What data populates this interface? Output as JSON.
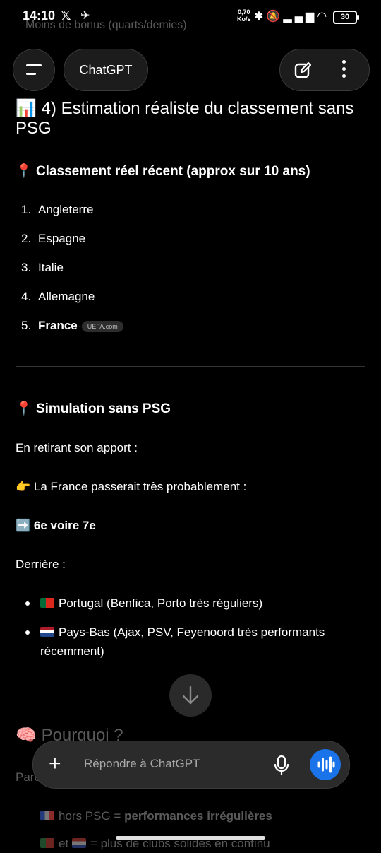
{
  "status": {
    "time": "14:10",
    "speed_value": "0,70",
    "speed_unit": "Ko/s",
    "battery": "30"
  },
  "top_faded": "Moins de bonus (quarts/demies)",
  "header": {
    "title": "ChatGPT"
  },
  "content": {
    "heading_icon": "📊",
    "heading": "4) Estimation réaliste du classement sans PSG",
    "section1_icon": "📍",
    "section1": "Classement réel récent (approx sur 10 ans)",
    "ranking": [
      {
        "n": "1.",
        "label": "Angleterre"
      },
      {
        "n": "2.",
        "label": "Espagne"
      },
      {
        "n": "3.",
        "label": "Italie"
      },
      {
        "n": "4.",
        "label": "Allemagne"
      },
      {
        "n": "5.",
        "label": "France",
        "badge": "UEFA.com"
      }
    ],
    "section2_icon": "📍",
    "section2": "Simulation sans PSG",
    "p1": "En retirant son apport :",
    "p2_icon": "👉",
    "p2": "La France passerait très probablement :",
    "p3_icon": "➡️",
    "p3": "6e voire 7e",
    "p4": "Derrière :",
    "bullets": [
      {
        "text": "Portugal (Benfica, Porto très réguliers)"
      },
      {
        "text": "Pays-Bas (Ajax, PSV, Feyenoord très performants récemment)"
      }
    ],
    "section3_icon": "🧠",
    "section3": "Pourquoi ?",
    "faded_para": "Parce que",
    "faded_b1_a": "hors PSG = ",
    "faded_b1_b": "performances irrégulières",
    "faded_b2_a": "et",
    "faded_b2_b": "= plus de clubs solides en continu"
  },
  "composer": {
    "placeholder": "Répondre à ChatGPT"
  },
  "colors": {
    "accent": "#1a73e8",
    "background": "#000000"
  }
}
